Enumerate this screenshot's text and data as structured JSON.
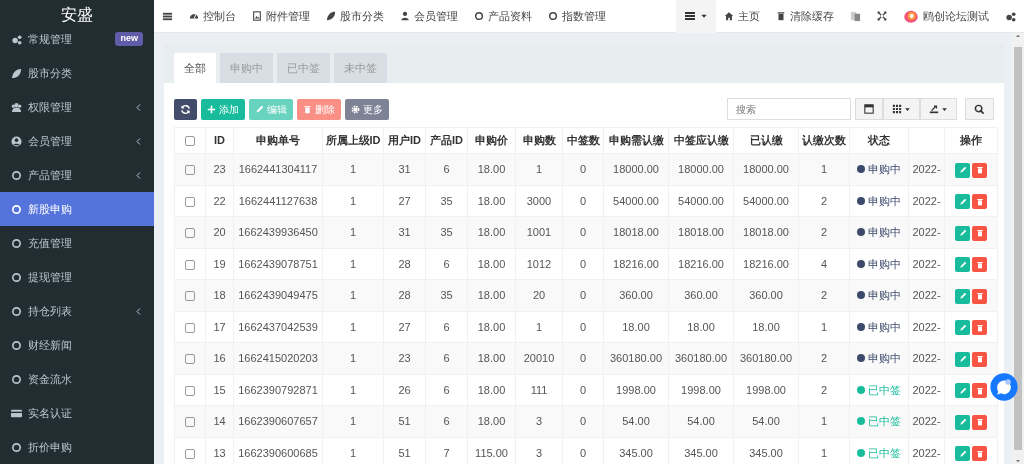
{
  "sidebar": {
    "title": "安盛",
    "items": [
      {
        "label": "常规管理",
        "badge": "new",
        "submenu": false,
        "selected": false
      },
      {
        "label": "股市分类",
        "submenu": false,
        "selected": false
      },
      {
        "label": "权限管理",
        "submenu": true,
        "selected": false
      },
      {
        "label": "会员管理",
        "submenu": true,
        "selected": false
      },
      {
        "label": "产品管理",
        "submenu": true,
        "selected": false
      },
      {
        "label": "新股申购",
        "submenu": false,
        "selected": true
      },
      {
        "label": "充值管理",
        "submenu": false,
        "selected": false
      },
      {
        "label": "提现管理",
        "submenu": false,
        "selected": false
      },
      {
        "label": "持仓列表",
        "submenu": true,
        "selected": false
      },
      {
        "label": "财经新闻",
        "submenu": false,
        "selected": false
      },
      {
        "label": "资金流水",
        "submenu": false,
        "selected": false
      },
      {
        "label": "实名认证",
        "submenu": false,
        "selected": false
      },
      {
        "label": "折价申购",
        "submenu": false,
        "selected": false
      }
    ]
  },
  "topnav": {
    "items": [
      "控制台",
      "附件管理",
      "股市分类",
      "会员管理",
      "产品资料",
      "指数管理"
    ],
    "right": [
      "主页",
      "清除缓存"
    ],
    "user": "鸥创论坛测试"
  },
  "tabs": [
    {
      "label": "全部",
      "selected": true
    },
    {
      "label": "申购中",
      "selected": false
    },
    {
      "label": "已中签",
      "selected": false
    },
    {
      "label": "未中签",
      "selected": false
    }
  ],
  "toolbar": [
    {
      "kind": "refresh",
      "disabled": false
    },
    {
      "kind": "add",
      "label": "添加",
      "disabled": false
    },
    {
      "kind": "edit",
      "label": "编辑",
      "disabled": true
    },
    {
      "kind": "delete",
      "label": "删除",
      "disabled": true
    },
    {
      "kind": "more",
      "label": "更多",
      "disabled": false
    }
  ],
  "search": {
    "placeholder": "搜索"
  },
  "table": {
    "select_all_checked": false,
    "columns": [
      "ID",
      "申购单号",
      "所属上级ID",
      "用户ID",
      "产品ID",
      "申购价",
      "申购数",
      "中签数",
      "申购需认缴",
      "中签应认缴",
      "已认缴",
      "认缴次数",
      "状态",
      "操作"
    ],
    "rows": [
      {
        "checked": false,
        "cells": [
          "23",
          "1662441304117",
          "1",
          "31",
          "6",
          "18.00",
          "1",
          "0",
          "18000.00",
          "18000.00",
          "18000.00",
          "1"
        ],
        "status": {
          "text": "申购中",
          "color": "#3d4a6b"
        },
        "date": "2022-"
      },
      {
        "checked": false,
        "cells": [
          "22",
          "1662441127638",
          "1",
          "27",
          "35",
          "18.00",
          "3000",
          "0",
          "54000.00",
          "54000.00",
          "54000.00",
          "2"
        ],
        "status": {
          "text": "申购中",
          "color": "#3d4a6b"
        },
        "date": "2022-"
      },
      {
        "checked": false,
        "cells": [
          "20",
          "1662439936450",
          "1",
          "31",
          "35",
          "18.00",
          "1001",
          "0",
          "18018.00",
          "18018.00",
          "18018.00",
          "2"
        ],
        "status": {
          "text": "申购中",
          "color": "#3d4a6b"
        },
        "date": "2022-"
      },
      {
        "checked": false,
        "cells": [
          "19",
          "1662439078751",
          "1",
          "28",
          "6",
          "18.00",
          "1012",
          "0",
          "18216.00",
          "18216.00",
          "18216.00",
          "4"
        ],
        "status": {
          "text": "申购中",
          "color": "#3d4a6b"
        },
        "date": "2022-"
      },
      {
        "checked": false,
        "cells": [
          "18",
          "1662439049475",
          "1",
          "28",
          "35",
          "18.00",
          "20",
          "0",
          "360.00",
          "360.00",
          "360.00",
          "2"
        ],
        "status": {
          "text": "申购中",
          "color": "#3d4a6b"
        },
        "date": "2022-"
      },
      {
        "checked": false,
        "cells": [
          "17",
          "1662437042539",
          "1",
          "27",
          "6",
          "18.00",
          "1",
          "0",
          "18.00",
          "18.00",
          "18.00",
          "1"
        ],
        "status": {
          "text": "申购中",
          "color": "#3d4a6b"
        },
        "date": "2022-"
      },
      {
        "checked": false,
        "cells": [
          "16",
          "1662415020203",
          "1",
          "23",
          "6",
          "18.00",
          "20010",
          "0",
          "360180.00",
          "360180.00",
          "360180.00",
          "2"
        ],
        "status": {
          "text": "申购中",
          "color": "#3d4a6b"
        },
        "date": "2022-"
      },
      {
        "checked": false,
        "cells": [
          "15",
          "1662390792871",
          "1",
          "26",
          "6",
          "18.00",
          "111",
          "0",
          "1998.00",
          "1998.00",
          "1998.00",
          "2"
        ],
        "status": {
          "text": "已中签",
          "color": "#18bc9c"
        },
        "date": "2022-"
      },
      {
        "checked": false,
        "cells": [
          "14",
          "1662390607657",
          "1",
          "51",
          "6",
          "18.00",
          "3",
          "0",
          "54.00",
          "54.00",
          "54.00",
          "1"
        ],
        "status": {
          "text": "已中签",
          "color": "#18bc9c"
        },
        "date": "2022-"
      },
      {
        "checked": false,
        "cells": [
          "13",
          "1662390600685",
          "1",
          "51",
          "7",
          "115.00",
          "3",
          "0",
          "345.00",
          "345.00",
          "345.00",
          "1"
        ],
        "status": {
          "text": "已中签",
          "color": "#18bc9c"
        },
        "date": "2022-"
      }
    ]
  }
}
